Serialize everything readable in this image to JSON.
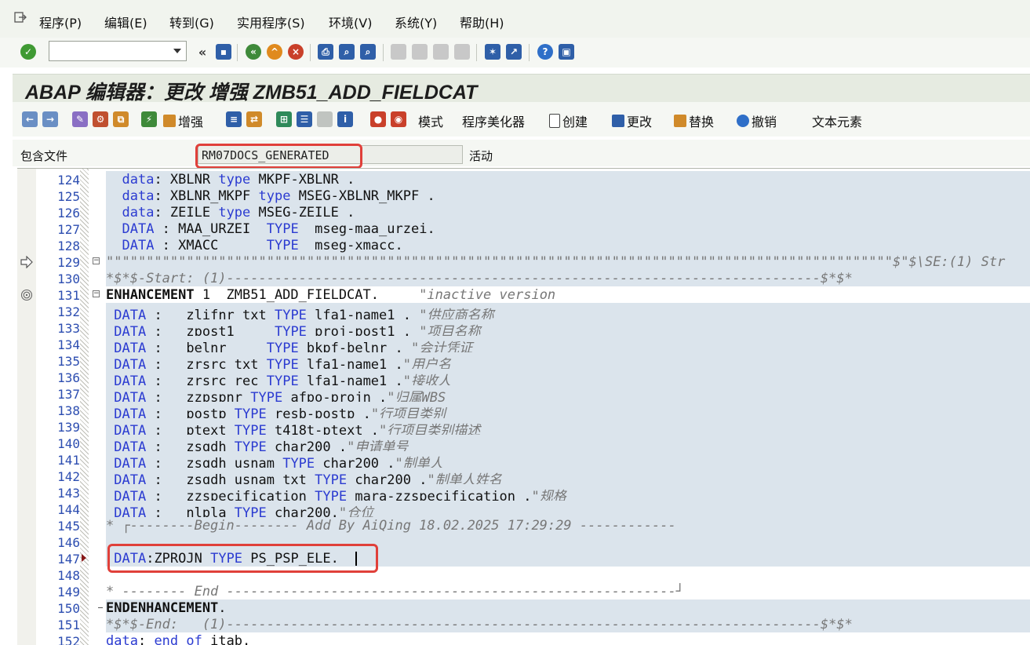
{
  "menu": {
    "items": [
      "程序(P)",
      "编辑(E)",
      "转到(G)",
      "实用程序(S)",
      "环境(V)",
      "系统(Y)",
      "帮助(H)"
    ]
  },
  "std_toolbar": {
    "command_field_value": "",
    "icons": [
      "checkmark-icon",
      "save-icon",
      "back-icon",
      "exit-icon",
      "cancel-icon",
      "print-icon",
      "find-icon",
      "find-next-icon",
      "first-page-icon",
      "prev-page-icon",
      "next-page-icon",
      "last-page-icon",
      "new-session-icon",
      "shortcut-icon",
      "help-icon",
      "customize-layout-icon"
    ]
  },
  "title": "ABAP 编辑器：更改 增强 ZMB51_ADD_FIELDCAT",
  "app_toolbar": {
    "enhance_label": "增强",
    "mode_label": "模式",
    "pretty_printer_label": "程序美化器",
    "create_label": "创建",
    "change_label": "更改",
    "replace_label": "替换",
    "undo_label": "撤销",
    "text_elements_label": "文本元素"
  },
  "include": {
    "label": "包含文件",
    "value": "RM07DOCS_GENERATED",
    "status": "活动"
  },
  "colors": {
    "keyword": "#2b3bd1",
    "comment": "#777777",
    "highlight_box": "#e0403a",
    "enhancement_bg": "#dbe4ec"
  },
  "editor": {
    "lines": [
      {
        "no": "124",
        "parts": [
          [
            "  ",
            ""
          ],
          [
            "data",
            "kw"
          ],
          [
            ": XBLNR ",
            ""
          ],
          [
            "type",
            "kw"
          ],
          [
            " MKPF-XBLNR .",
            ""
          ]
        ]
      },
      {
        "no": "125",
        "parts": [
          [
            "  ",
            ""
          ],
          [
            "data",
            "kw"
          ],
          [
            ": XBLNR_MKPF ",
            ""
          ],
          [
            "type",
            "kw"
          ],
          [
            " MSEG-XBLNR_MKPF .",
            ""
          ]
        ]
      },
      {
        "no": "126",
        "parts": [
          [
            "  ",
            ""
          ],
          [
            "data",
            "kw"
          ],
          [
            ": ZEILE ",
            ""
          ],
          [
            "type",
            "kw"
          ],
          [
            " MSEG-ZEILE .",
            ""
          ]
        ]
      },
      {
        "no": "127",
        "parts": [
          [
            "  ",
            ""
          ],
          [
            "DATA",
            "kw"
          ],
          [
            " : MAA_URZEI  ",
            ""
          ],
          [
            "TYPE",
            "kw"
          ],
          [
            "  mseg-maa_urzei.",
            ""
          ]
        ]
      },
      {
        "no": "128",
        "parts": [
          [
            "  ",
            ""
          ],
          [
            "DATA",
            "kw"
          ],
          [
            " : XMACC      ",
            ""
          ],
          [
            "TYPE",
            "kw"
          ],
          [
            "  mseg-xmacc.",
            ""
          ]
        ]
      },
      {
        "no": "129",
        "parts": [
          [
            "\"\"\"\"\"\"\"\"\"\"\"\"\"\"\"\"\"\"\"\"\"\"\"\"\"\"\"\"\"\"\"\"\"\"\"\"\"\"\"\"\"\"\"\"\"\"\"\"\"\"\"\"\"\"\"\"\"\"\"\"\"\"\"\"\"\"\"\"\"\"\"\"\"\"\"\"\"\"\"\"\"\"\"\"\"\"\"\"\"\"\"\"\"\"\"\"\"\"$\"$\\SE:(1) Str",
            "cm"
          ]
        ]
      },
      {
        "no": "130",
        "parts": [
          [
            "*$*$-Start: (1)--------------------------------------------------------------------------$*$*",
            "cm"
          ]
        ]
      },
      {
        "no": "131",
        "parts": [
          [
            "ENHANCEMENT",
            "bold"
          ],
          [
            " 1  ZMB51_ADD_FIELDCAT.     ",
            ""
          ],
          [
            "\"inactive version",
            "cm"
          ]
        ]
      },
      {
        "no": "132",
        "parts": [
          [
            " ",
            ""
          ],
          [
            "DATA",
            "kw"
          ],
          [
            " :   zlifnr_txt ",
            ""
          ],
          [
            "TYPE",
            "kw"
          ],
          [
            " lfa1-name1 . ",
            ""
          ],
          [
            "\"供应商名称",
            "cm"
          ]
        ]
      },
      {
        "no": "133",
        "parts": [
          [
            " ",
            ""
          ],
          [
            "DATA",
            "kw"
          ],
          [
            " :   zpost1     ",
            ""
          ],
          [
            "TYPE",
            "kw"
          ],
          [
            " proj-post1 . ",
            ""
          ],
          [
            "\"项目名称",
            "cm"
          ]
        ]
      },
      {
        "no": "134",
        "parts": [
          [
            " ",
            ""
          ],
          [
            "DATA",
            "kw"
          ],
          [
            " :   belnr     ",
            ""
          ],
          [
            "TYPE",
            "kw"
          ],
          [
            " bkpf-belnr . ",
            ""
          ],
          [
            "\"会计凭证",
            "cm"
          ]
        ]
      },
      {
        "no": "135",
        "parts": [
          [
            " ",
            ""
          ],
          [
            "DATA",
            "kw"
          ],
          [
            " :   zrsrc_txt ",
            ""
          ],
          [
            "TYPE",
            "kw"
          ],
          [
            " lfa1-name1 .",
            ""
          ],
          [
            "\"用户名",
            "cm"
          ]
        ]
      },
      {
        "no": "136",
        "parts": [
          [
            " ",
            ""
          ],
          [
            "DATA",
            "kw"
          ],
          [
            " :   zrsrc_rec ",
            ""
          ],
          [
            "TYPE",
            "kw"
          ],
          [
            " lfa1-name1 .",
            ""
          ],
          [
            "\"接收人",
            "cm"
          ]
        ]
      },
      {
        "no": "137",
        "parts": [
          [
            " ",
            ""
          ],
          [
            "DATA",
            "kw"
          ],
          [
            " :   zzpspnr ",
            ""
          ],
          [
            "TYPE",
            "kw"
          ],
          [
            " afpo-projn .",
            ""
          ],
          [
            "\"归属WBS",
            "cm"
          ]
        ]
      },
      {
        "no": "138",
        "parts": [
          [
            " ",
            ""
          ],
          [
            "DATA",
            "kw"
          ],
          [
            " :   postp ",
            ""
          ],
          [
            "TYPE",
            "kw"
          ],
          [
            " resb-postp .",
            ""
          ],
          [
            "\"行项目类别",
            "cm"
          ]
        ]
      },
      {
        "no": "139",
        "parts": [
          [
            " ",
            ""
          ],
          [
            "DATA",
            "kw"
          ],
          [
            " :   ptext ",
            ""
          ],
          [
            "TYPE",
            "kw"
          ],
          [
            " t418t-ptext .",
            ""
          ],
          [
            "\"行项目类别描述",
            "cm"
          ]
        ]
      },
      {
        "no": "140",
        "parts": [
          [
            " ",
            ""
          ],
          [
            "DATA",
            "kw"
          ],
          [
            " :   zsqdh ",
            ""
          ],
          [
            "TYPE",
            "kw"
          ],
          [
            " char200 .",
            ""
          ],
          [
            "\"申请单号",
            "cm"
          ]
        ]
      },
      {
        "no": "141",
        "parts": [
          [
            " ",
            ""
          ],
          [
            "DATA",
            "kw"
          ],
          [
            " :   zsqdh_usnam ",
            ""
          ],
          [
            "TYPE",
            "kw"
          ],
          [
            " char200 .",
            ""
          ],
          [
            "\"制单人",
            "cm"
          ]
        ]
      },
      {
        "no": "142",
        "parts": [
          [
            " ",
            ""
          ],
          [
            "DATA",
            "kw"
          ],
          [
            " :   zsqdh_usnam_txt ",
            ""
          ],
          [
            "TYPE",
            "kw"
          ],
          [
            " char200 .",
            ""
          ],
          [
            "\"制单人姓名",
            "cm"
          ]
        ]
      },
      {
        "no": "143",
        "parts": [
          [
            " ",
            ""
          ],
          [
            "DATA",
            "kw"
          ],
          [
            " :   zzspecification ",
            ""
          ],
          [
            "TYPE",
            "kw"
          ],
          [
            " mara-zzspecification .",
            ""
          ],
          [
            "\"规格",
            "cm"
          ]
        ]
      },
      {
        "no": "144",
        "parts": [
          [
            " ",
            ""
          ],
          [
            "DATA",
            "kw"
          ],
          [
            " :   nlpla ",
            ""
          ],
          [
            "TYPE",
            "kw"
          ],
          [
            " char200.",
            ""
          ],
          [
            "\"仓位",
            "cm"
          ]
        ]
      },
      {
        "no": "145",
        "parts": [
          [
            "* ┌--------Begin-------- Add By AiQing 18.02.2025 17:29:29 ------------",
            "cm"
          ]
        ]
      },
      {
        "no": "146",
        "parts": []
      },
      {
        "no": "147",
        "parts": [
          [
            " ",
            ""
          ],
          [
            "DATA",
            "kw"
          ],
          [
            ":ZPROJN ",
            ""
          ],
          [
            "TYPE",
            "kw"
          ],
          [
            " PS_PSP_ELE.",
            ""
          ]
        ]
      },
      {
        "no": "148",
        "parts": []
      },
      {
        "no": "149",
        "parts": [
          [
            "* -------- End --------------------------------------------------------┘",
            "cm"
          ]
        ]
      },
      {
        "no": "150",
        "parts": [
          [
            "ENDENHANCEMENT",
            "bold"
          ],
          [
            ".",
            ""
          ]
        ]
      },
      {
        "no": "151",
        "parts": [
          [
            "*$*$-End:   (1)--------------------------------------------------------------------------$*$*",
            "cm"
          ]
        ]
      },
      {
        "no": "152",
        "parts": [
          [
            "data",
            "kw"
          ],
          [
            ": ",
            ""
          ],
          [
            "end of",
            "kw"
          ],
          [
            " itab.",
            ""
          ]
        ]
      }
    ]
  }
}
